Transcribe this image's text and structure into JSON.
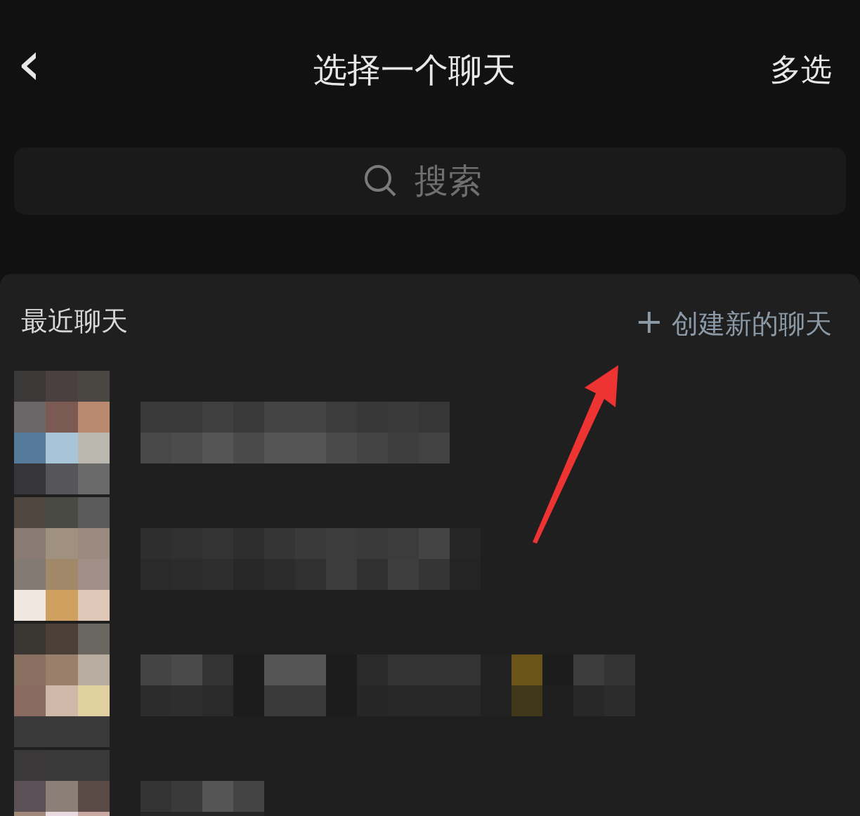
{
  "nav": {
    "back_icon": "‹",
    "title": "选择一个聊天",
    "action": "多选"
  },
  "search": {
    "placeholder": "搜索"
  },
  "section": {
    "title": "最近聊天",
    "action_icon": "+",
    "action": "创建新的聊天"
  },
  "annotation": {
    "kind": "arrow"
  }
}
